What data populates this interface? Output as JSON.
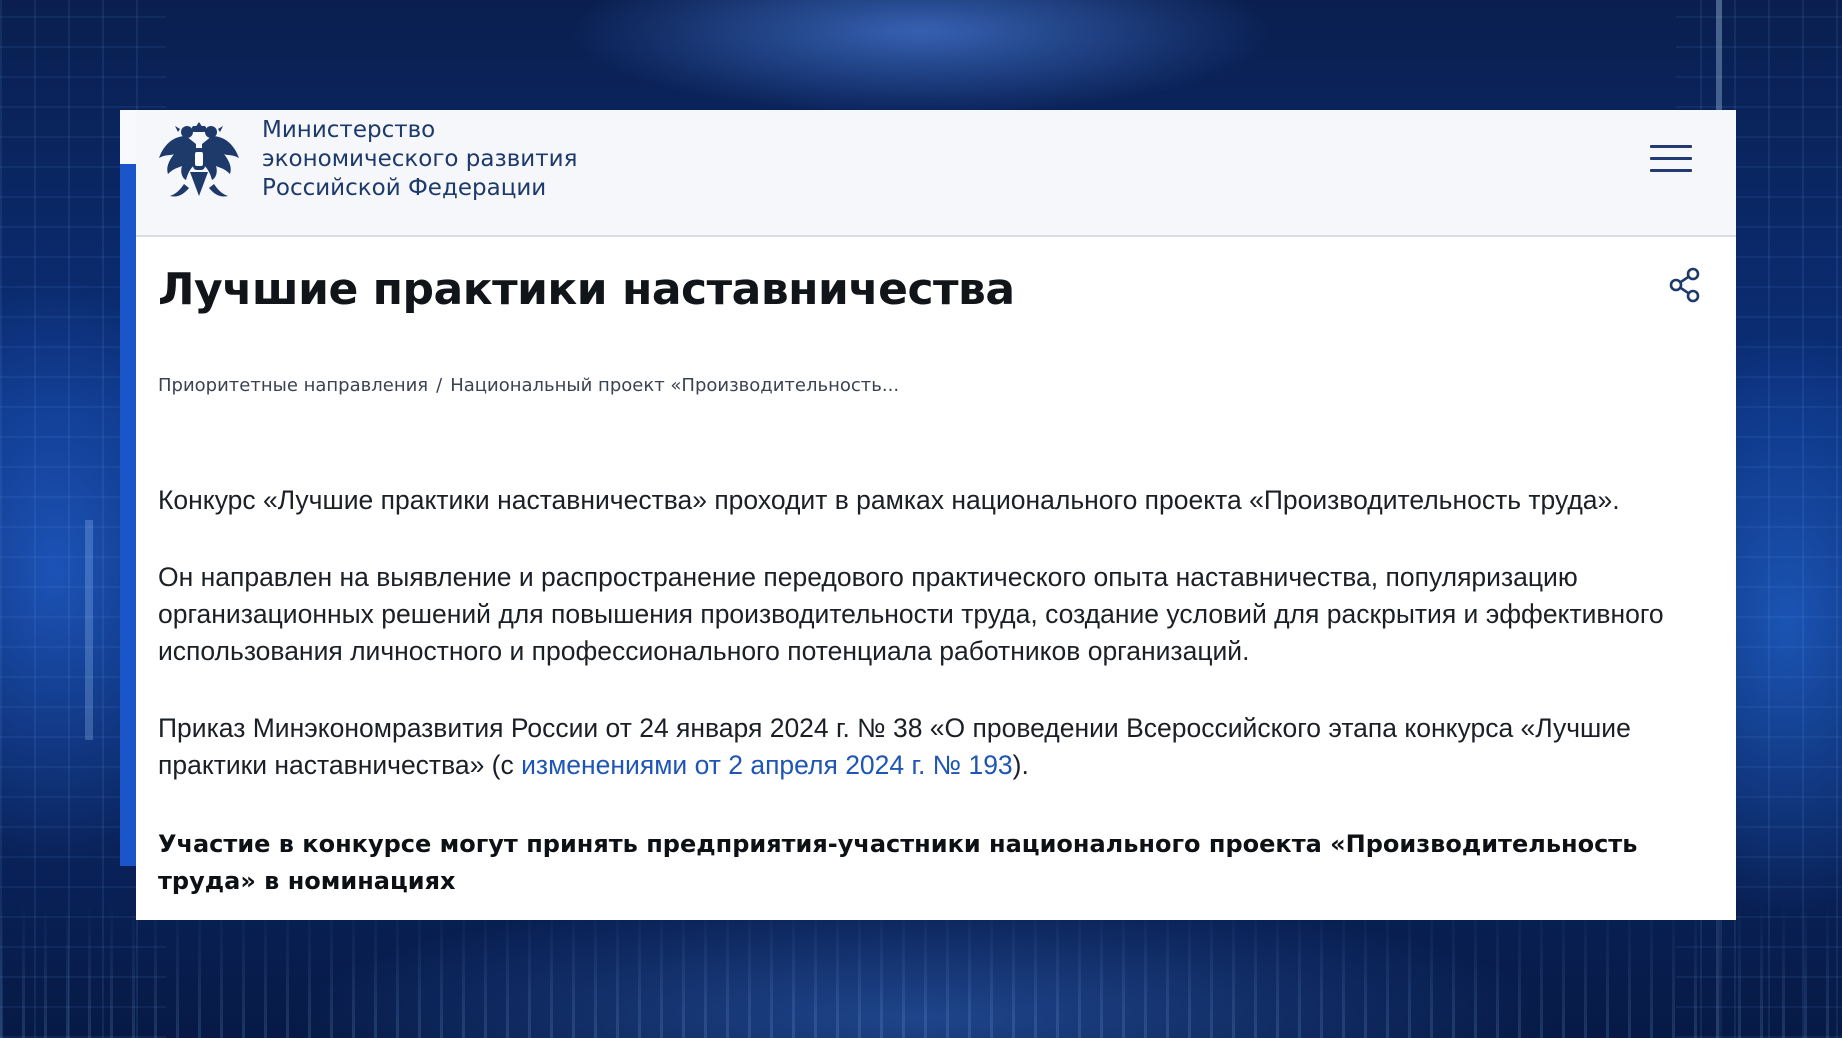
{
  "header": {
    "ministry_name_lines": [
      "Министерство",
      "экономического развития",
      "Российской Федерации"
    ],
    "logo_icon": "double-headed-eagle-emblem",
    "menu_icon": "hamburger-menu-icon"
  },
  "page": {
    "title": "Лучшие практики наставничества",
    "share_icon": "share-icon"
  },
  "breadcrumb": {
    "items": [
      "Приоритетные направления",
      "Национальный проект «Производительность..."
    ],
    "separator": "/"
  },
  "content": {
    "p1": "Конкурс «Лучшие практики наставничества» проходит в рамках национального проекта «Производительность труда».",
    "p2": "Он направлен на выявление и распространение передового практического опыта наставничества, популяризацию организационных решений для повышения производительности труда, создание условий для раскрытия и эффективного использования личностного и профессионального потенциала работников организаций.",
    "p3_before": "Приказ Минэкономразвития России от 24 января 2024 г. № 38 «О проведении Всероссийского этапа конкурса «Лучшие практики наставничества» (с ",
    "p3_link": "изменениями от 2 апреля 2024 г. № 193",
    "p3_after": ").",
    "p4": "Участие в конкурсе могут принять предприятия-участники национального проекта «Производительность труда» в номинациях"
  },
  "colors": {
    "brand_navy": "#1d3a6b",
    "link": "#1f55b5",
    "background_blue": "#0b2f7a"
  }
}
